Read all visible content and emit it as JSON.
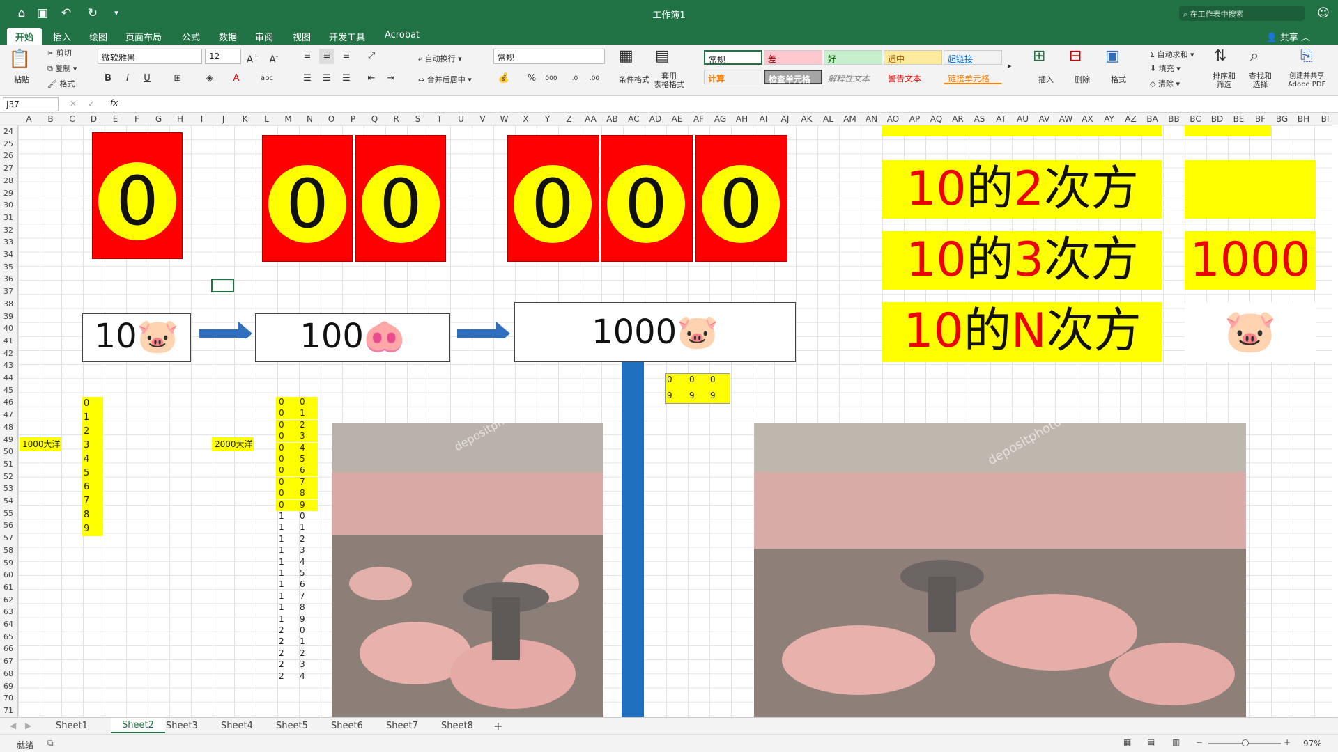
{
  "window": {
    "title": "工作簿1",
    "search_placeholder": "在工作表中搜索",
    "share": "共享"
  },
  "menu": [
    "开始",
    "插入",
    "绘图",
    "页面布局",
    "公式",
    "数据",
    "审阅",
    "视图",
    "开发工具",
    "Acrobat"
  ],
  "ribbon": {
    "paste": "粘贴",
    "cut": "剪切",
    "copy": "复制",
    "format_painter": "格式",
    "font_name": "微软雅黑",
    "font_size": "12",
    "wrap_text": "自动换行",
    "merge_center": "合并后居中",
    "number_format": "常规",
    "conditional_format": "条件格式",
    "table_format": "套用\n表格格式",
    "styles": {
      "normal": "常规",
      "bad": "差",
      "good": "好",
      "neutral": "适中",
      "hyperlink": "超链接",
      "calculation": "计算",
      "check_cell": "检查单元格",
      "explanatory": "解释性文本",
      "warning": "警告文本",
      "linked_cell": "链接单元格"
    },
    "insert": "插入",
    "delete": "删除",
    "format": "格式",
    "autosum": "自动求和",
    "fill": "填充",
    "clear": "清除",
    "sort_filter": "排序和\n筛选",
    "find_select": "查找和\n选择",
    "create_share_pdf": "创建并共享\nAdobe PDF"
  },
  "formula": {
    "cell_ref": "J37",
    "fx": "fx",
    "value": ""
  },
  "columns": [
    "A",
    "B",
    "C",
    "D",
    "E",
    "F",
    "G",
    "H",
    "I",
    "J",
    "K",
    "L",
    "M",
    "N",
    "O",
    "P",
    "Q",
    "R",
    "S",
    "T",
    "U",
    "V",
    "W",
    "X",
    "Y",
    "Z",
    "AA",
    "AB",
    "AC",
    "AD",
    "AE",
    "AF",
    "AG",
    "AH",
    "AI",
    "AJ",
    "AK",
    "AL",
    "AM",
    "AN",
    "AO",
    "AP",
    "AQ",
    "AR",
    "AS",
    "AT",
    "AU",
    "AV",
    "AW",
    "AX",
    "AY",
    "AZ",
    "BA",
    "BB",
    "BC",
    "BD",
    "BE",
    "BF",
    "BG",
    "BH",
    "BI"
  ],
  "rows": [
    "24",
    "25",
    "26",
    "27",
    "28",
    "29",
    "30",
    "31",
    "32",
    "33",
    "34",
    "35",
    "36",
    "37",
    "38",
    "39",
    "40",
    "41",
    "42",
    "43",
    "44",
    "45",
    "46",
    "47",
    "48",
    "49",
    "50",
    "51",
    "52",
    "53",
    "54",
    "55",
    "56",
    "57",
    "58",
    "59",
    "60",
    "61",
    "62",
    "63",
    "64",
    "65",
    "66",
    "67",
    "68",
    "69",
    "70",
    "71"
  ],
  "counters": {
    "digit": "0"
  },
  "flow": {
    "box1": "10🐷",
    "box2": "100🐽",
    "box3": "1000🐷"
  },
  "powers": {
    "p2": [
      "10",
      "的",
      "2",
      "次方"
    ],
    "p3": [
      "10",
      "的",
      "3",
      "次方"
    ],
    "pn": [
      "10",
      "的",
      "N",
      "次方"
    ],
    "v3": "1000",
    "pig": "🐷"
  },
  "labels": {
    "a50": "1000大洋",
    "j50": "2000大洋"
  },
  "col_d": [
    "0",
    "1",
    "2",
    "3",
    "4",
    "5",
    "6",
    "7",
    "8",
    "9"
  ],
  "col_l": [
    "0",
    "0",
    "0",
    "0",
    "0",
    "0",
    "0",
    "0",
    "0",
    "0",
    "1",
    "1",
    "1",
    "1",
    "1",
    "1",
    "1",
    "1",
    "1",
    "1",
    "2",
    "2",
    "2",
    "2",
    "2"
  ],
  "col_m": [
    "0",
    "1",
    "2",
    "3",
    "4",
    "5",
    "6",
    "7",
    "8",
    "9",
    "0",
    "1",
    "2",
    "3",
    "4",
    "5",
    "6",
    "7",
    "8",
    "9",
    "0",
    "1",
    "2",
    "3",
    "4"
  ],
  "small_grid": {
    "top": [
      "0",
      "0",
      "0"
    ],
    "bottom": [
      "9",
      "9",
      "9"
    ]
  },
  "watermark": "depositphotos",
  "sheets": [
    "Sheet1",
    "Sheet2",
    "Sheet3",
    "Sheet4",
    "Sheet5",
    "Sheet6",
    "Sheet7",
    "Sheet8"
  ],
  "active_sheet": "Sheet2",
  "status": {
    "ready": "就绪",
    "zoom": "97%"
  }
}
